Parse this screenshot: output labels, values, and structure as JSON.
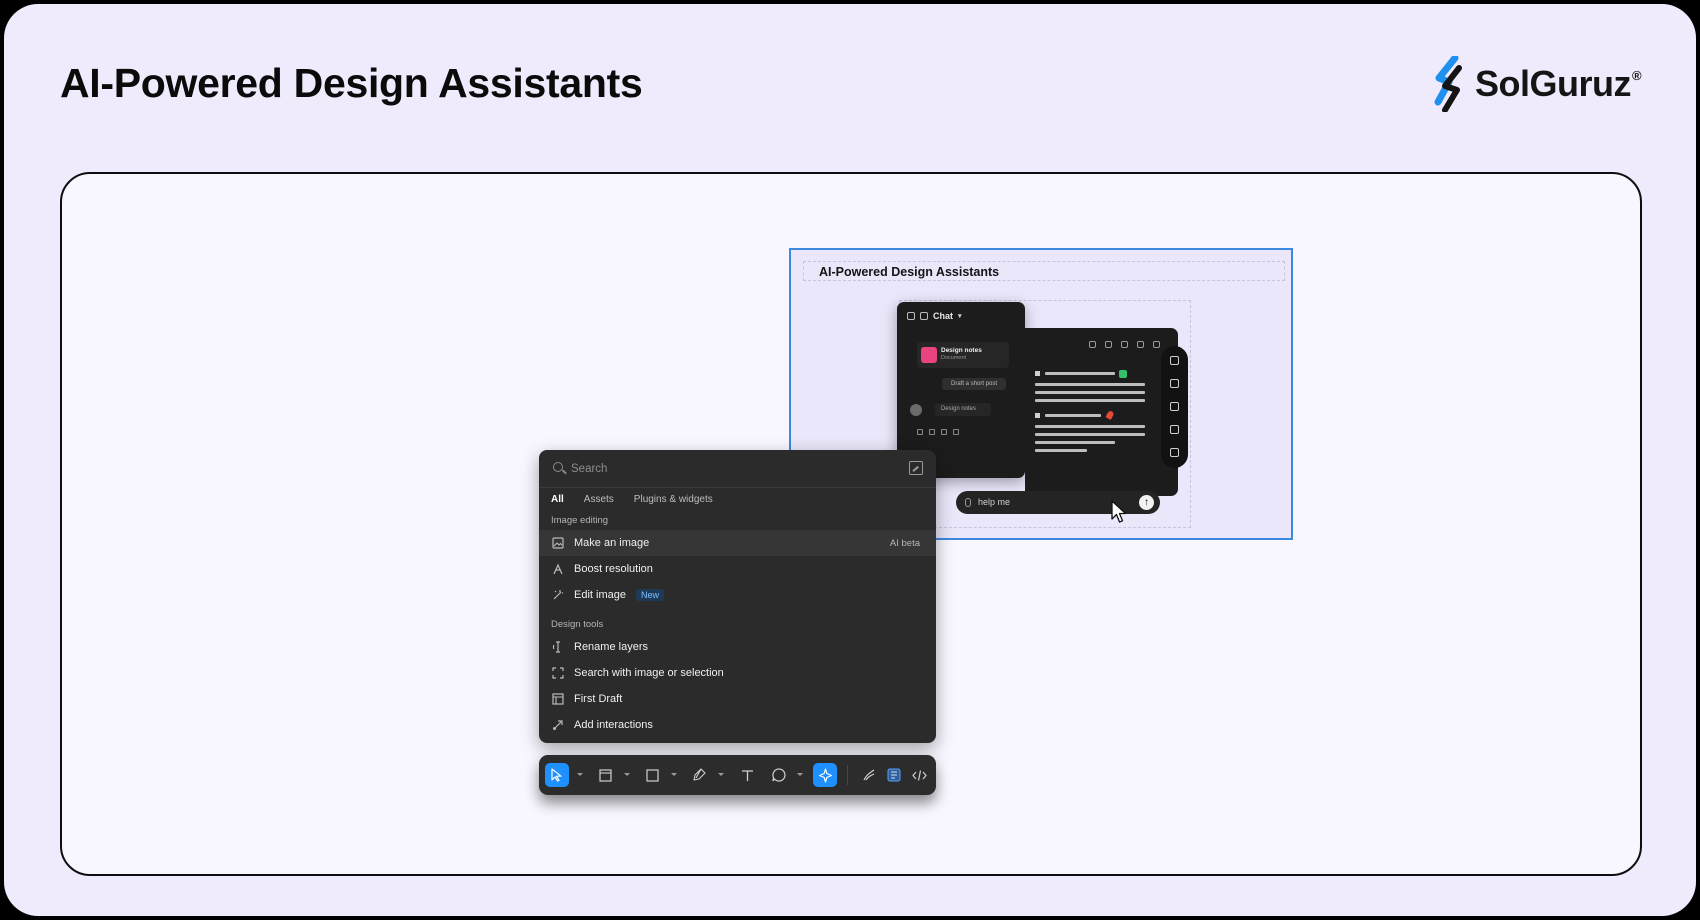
{
  "slide": {
    "title": "AI-Powered Design Assistants",
    "logo_text": "SolGuruz",
    "logo_mark": "®"
  },
  "colors": {
    "slide_bg": "#f0ebfc",
    "panel_bg": "#2b2b2b",
    "accent": "#1e90ff",
    "selection": "#3b8ae0",
    "logo_blue": "#1f8ff0"
  },
  "canvas": {
    "frame_title": "AI-Powered Design Assistants",
    "chat": {
      "mode_label": "Chat",
      "card_title": "Design notes",
      "card_subtitle": "Document",
      "prompt_chip": "Draft a short post",
      "file_chip": "Design notes"
    },
    "input_text": "help me"
  },
  "panel": {
    "search_placeholder": "Search",
    "tabs": [
      {
        "label": "All",
        "active": true
      },
      {
        "label": "Assets",
        "active": false
      },
      {
        "label": "Plugins & widgets",
        "active": false
      }
    ],
    "sections": [
      {
        "label": "Image editing",
        "items": [
          {
            "label": "Make an image",
            "badge": "AI beta",
            "icon": "image-icon",
            "highlighted": true
          },
          {
            "label": "Boost resolution",
            "icon": "boost-icon"
          },
          {
            "label": "Edit image",
            "badge": "New",
            "icon": "magic-wand-icon"
          }
        ]
      },
      {
        "label": "Design tools",
        "items": [
          {
            "label": "Rename layers",
            "icon": "rename-icon"
          },
          {
            "label": "Search with image or selection",
            "icon": "scan-icon"
          },
          {
            "label": "First Draft",
            "icon": "layout-icon"
          },
          {
            "label": "Add interactions",
            "icon": "interactions-icon"
          }
        ]
      }
    ]
  },
  "toolbar": {
    "tools": [
      "move-icon",
      "frame-icon",
      "rectangle-icon",
      "pen-icon",
      "text-icon",
      "comment-icon",
      "actions-icon",
      "draw-icon",
      "dev-mode-icon",
      "code-icon"
    ],
    "active_tool": "actions-icon"
  }
}
